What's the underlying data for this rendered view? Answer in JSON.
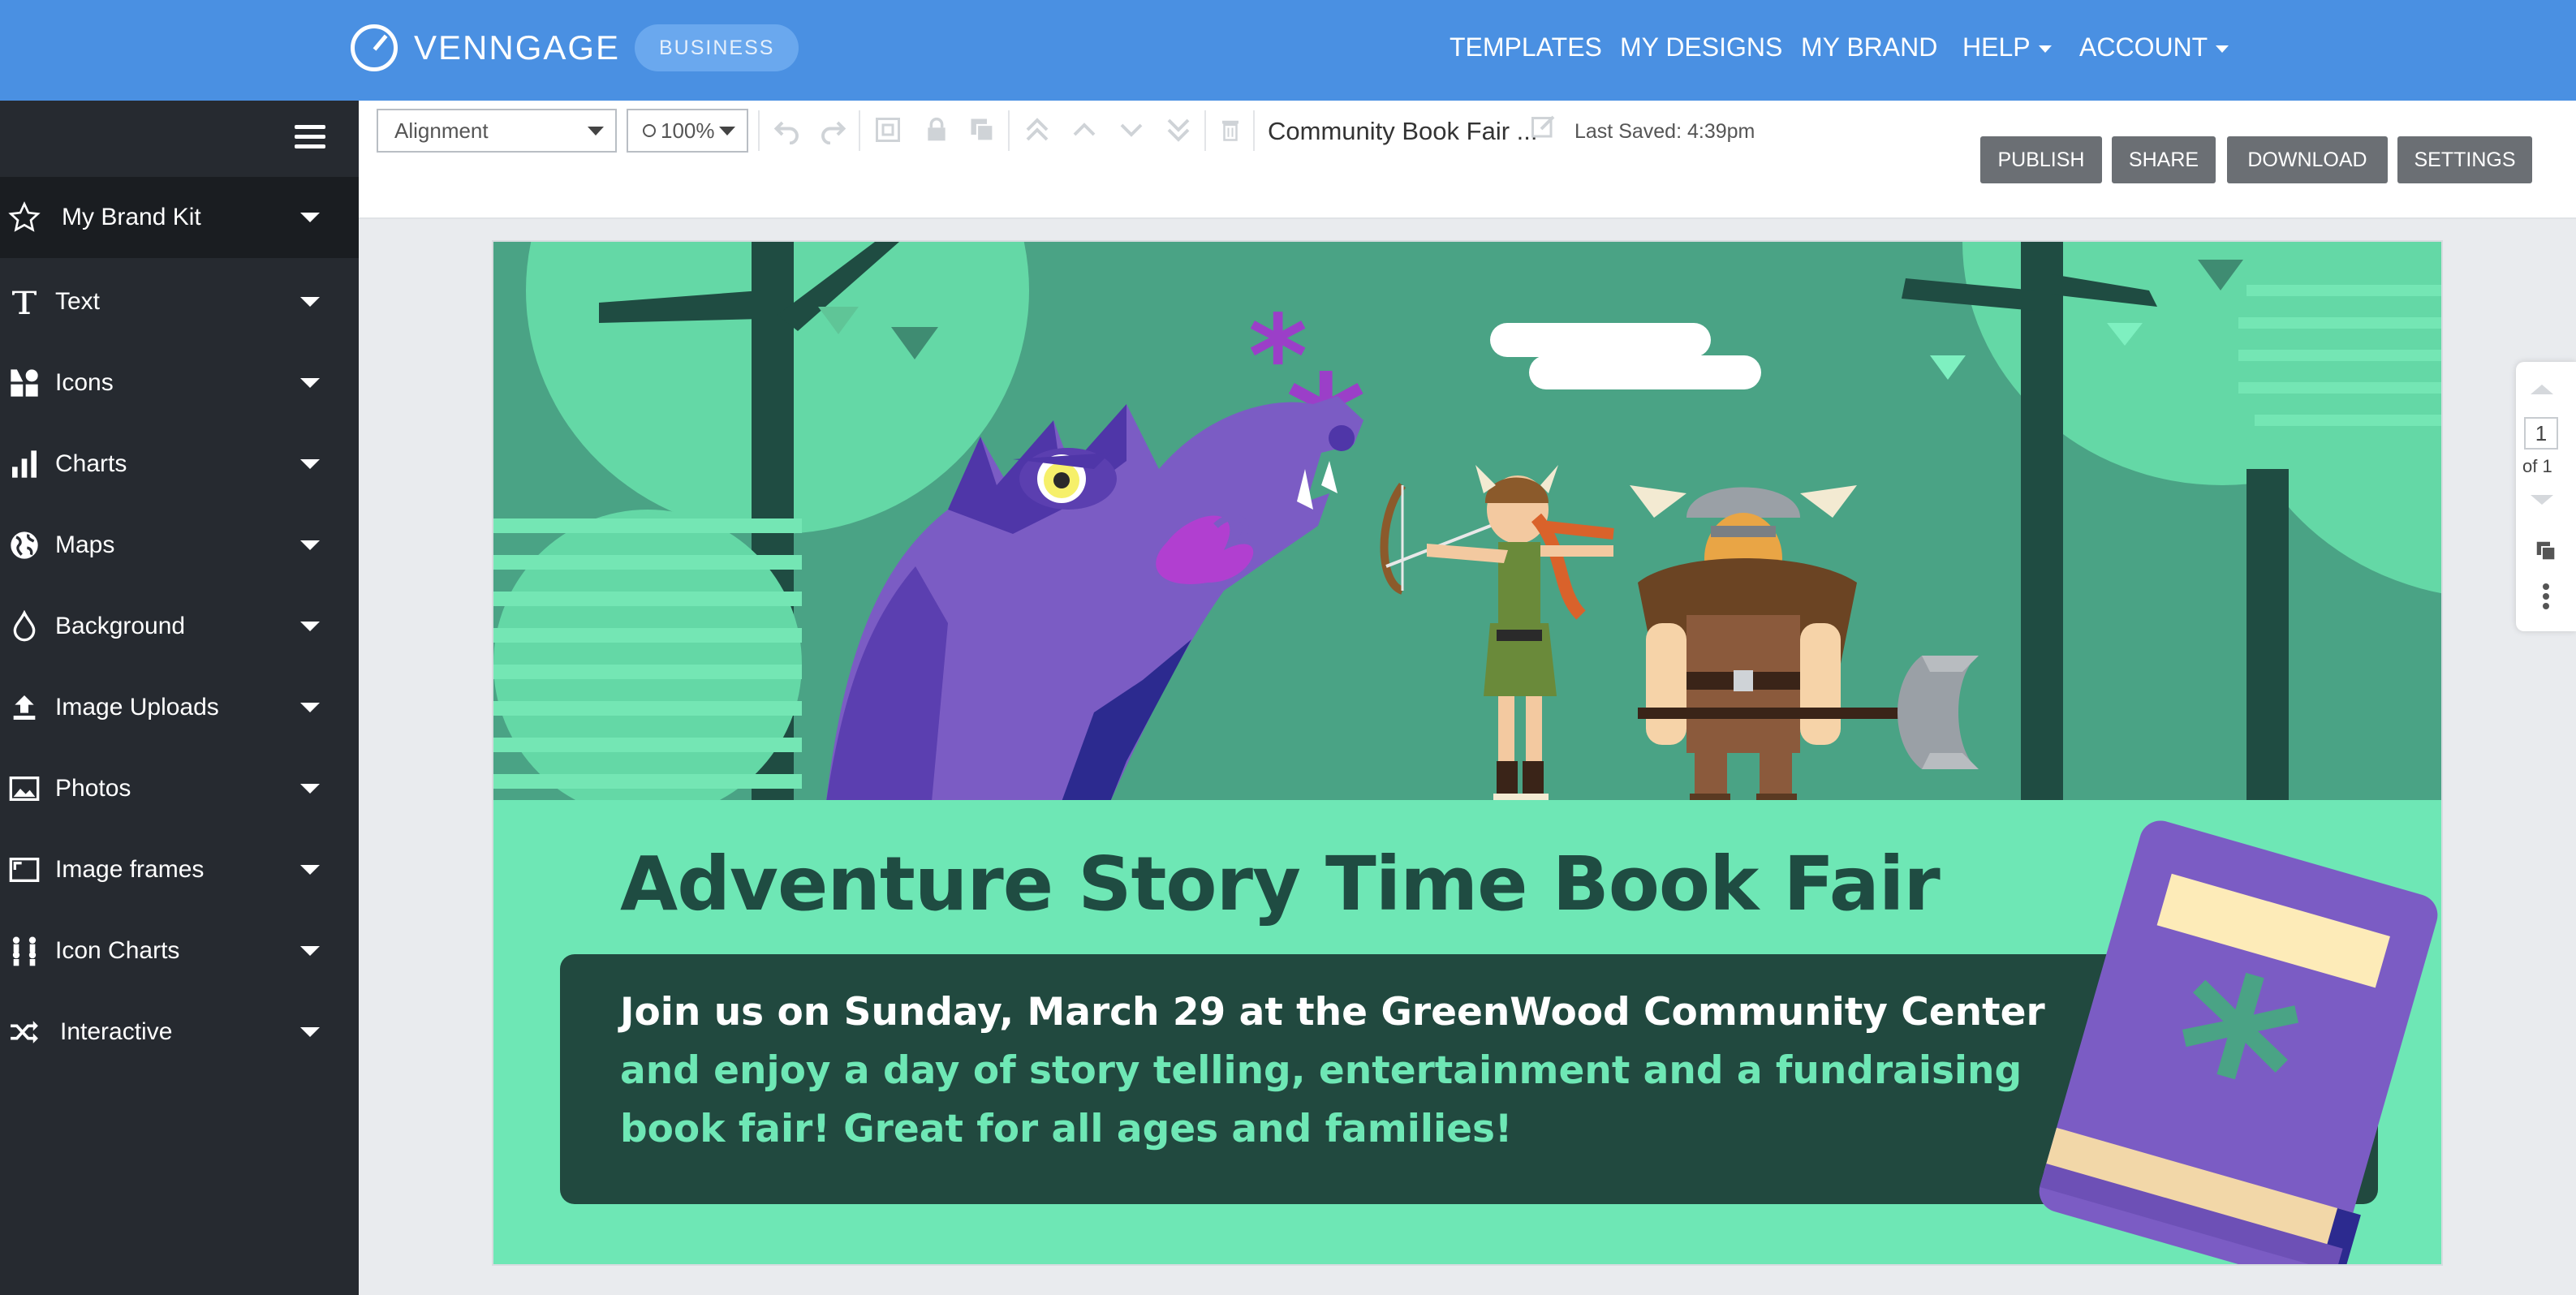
{
  "app": {
    "brand": "VENNGAGE",
    "plan_badge": "BUSINESS"
  },
  "topnav": {
    "templates": "TEMPLATES",
    "my_designs": "MY DESIGNS",
    "my_brand": "MY BRAND",
    "help": "HELP",
    "account": "ACCOUNT"
  },
  "sidebar": {
    "items": [
      {
        "label": "My Brand Kit",
        "icon": "star-icon"
      },
      {
        "label": "Text",
        "icon": "text-icon"
      },
      {
        "label": "Icons",
        "icon": "shapes-icon"
      },
      {
        "label": "Charts",
        "icon": "bar-chart-icon"
      },
      {
        "label": "Maps",
        "icon": "globe-icon"
      },
      {
        "label": "Background",
        "icon": "droplet-icon"
      },
      {
        "label": "Image Uploads",
        "icon": "upload-icon"
      },
      {
        "label": "Photos",
        "icon": "photo-icon"
      },
      {
        "label": "Image frames",
        "icon": "frame-icon"
      },
      {
        "label": "Icon Charts",
        "icon": "people-chart-icon"
      },
      {
        "label": "Interactive",
        "icon": "shuffle-icon"
      }
    ]
  },
  "toolbar": {
    "alignment": "Alignment",
    "zoom": "100%",
    "doc_title": "Community Book Fair ...",
    "last_saved": "Last Saved: 4:39pm",
    "publish": "PUBLISH",
    "share": "SHARE",
    "download": "DOWNLOAD",
    "settings": "SETTINGS"
  },
  "canvas": {
    "headline": "Adventure Story Time Book Fair",
    "line1": "Join us on Sunday, March 29 at the GreenWood Community Center",
    "line2": "and enjoy a day of story telling, entertainment and a fundraising",
    "line3": "book fair! Great for all ages and families!",
    "colors": {
      "scene_bg": "#4aa385",
      "ground": "#6ee7b5",
      "box": "#21493f",
      "dragon": "#7b5cc4",
      "book": "#7b5cc4"
    }
  },
  "pages": {
    "current": "1",
    "of": "of 1"
  }
}
